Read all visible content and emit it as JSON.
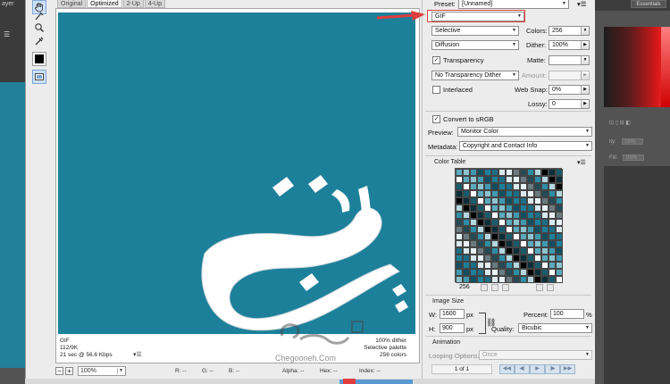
{
  "background_app": {
    "left_label": "ayer",
    "workspace_button": "Essentials",
    "panel_rows": [
      {
        "label": "ity:",
        "value": "100%"
      },
      {
        "label": "Fill:",
        "value": "100%"
      }
    ]
  },
  "tabs": [
    {
      "label": "Original",
      "active": false
    },
    {
      "label": "Optimized",
      "active": true
    },
    {
      "label": "2-Up",
      "active": false
    },
    {
      "label": "4-Up",
      "active": false
    }
  ],
  "tools": [
    "hand-tool-icon",
    "slice-select-tool-icon",
    "zoom-tool-icon",
    "eyedropper-tool-icon",
    "eyedropper-color-icon",
    "toggle-slices-icon"
  ],
  "canvas": {
    "background_color": "#1d809a",
    "info_left": [
      "GIF",
      "112/9K",
      "21 sec @ 56.6 Kbps"
    ],
    "info_right": [
      "100% dither",
      "Selective palette",
      "256 colors"
    ]
  },
  "statusbar": {
    "zoom": "100%",
    "r": "R: --",
    "g": "G: --",
    "b": "B: --",
    "alpha": "Alpha: --",
    "hex": "Hex: --",
    "index": "Index: --"
  },
  "watermark": {
    "text": "Chegooneh.Com"
  },
  "settings": {
    "preset_label": "Preset:",
    "preset_value": "[Unnamed]",
    "format": "GIF",
    "reduction": "Selective",
    "colors_label": "Colors:",
    "colors_value": "256",
    "dither_algo": "Diffusion",
    "dither_label": "Dither:",
    "dither_value": "100%",
    "transparency_label": "Transparency",
    "transparency_checked": true,
    "matte_label": "Matte:",
    "matte_value": "",
    "transparency_dither": "No Transparency Dither",
    "amount_label": "Amount:",
    "amount_value": "",
    "interlaced_label": "Interlaced",
    "interlaced_checked": false,
    "websnap_label": "Web Snap:",
    "websnap_value": "0%",
    "lossy_label": "Lossy:",
    "lossy_value": "0",
    "convert_srgb_label": "Convert to sRGB",
    "convert_srgb_checked": true,
    "preview_label": "Preview:",
    "preview_value": "Monitor Color",
    "metadata_label": "Metadata:",
    "metadata_value": "Copyright and Contact Info"
  },
  "color_table": {
    "title": "Color Table",
    "count": "256"
  },
  "image_size": {
    "title": "Image Size",
    "w_label": "W:",
    "w_value": "1600",
    "h_label": "H:",
    "h_value": "900",
    "unit": "px",
    "percent_label": "Percent:",
    "percent_value": "100",
    "percent_unit": "%",
    "quality_label": "Quality:",
    "quality_value": "Bicubic"
  },
  "animation": {
    "title": "Animation",
    "looping_label": "Looping Options:",
    "looping_value": "Once",
    "frame_counter": "1 of 1"
  },
  "colors": {
    "accent_red": "#e13d3d",
    "canvas_teal": "#1d809a"
  }
}
